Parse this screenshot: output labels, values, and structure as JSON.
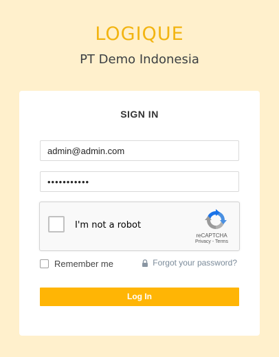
{
  "header": {
    "logo_text": "LOGIQUE",
    "company_name": "PT Demo Indonesia"
  },
  "login": {
    "title": "SIGN IN",
    "email_value": "admin@admin.com",
    "password_value": "•••••••••••",
    "recaptcha": {
      "label": "I'm not a robot",
      "brand": "reCAPTCHA",
      "terms": "Privacy - Terms"
    },
    "remember_label": "Remember me",
    "forgot_label": "Forgot your password?",
    "submit_label": "Log In"
  },
  "colors": {
    "background": "#fff0cc",
    "brand": "#f2b411",
    "button": "#ffb505"
  },
  "icons": {
    "lock": "lock-icon",
    "recaptcha": "recaptcha-logo-icon"
  }
}
